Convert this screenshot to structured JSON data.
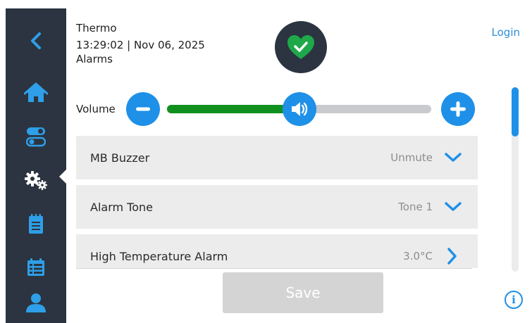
{
  "header": {
    "device_name": "Thermo",
    "datetime": "13:29:02 | Nov 06, 2025",
    "page_title": "Alarms",
    "login_label": "Login",
    "status_icon": "heart-check-icon"
  },
  "sidebar": {
    "items": [
      {
        "name": "back",
        "icon": "chevron-left-icon"
      },
      {
        "name": "home",
        "icon": "home-icon"
      },
      {
        "name": "controls",
        "icon": "toggle-icon"
      },
      {
        "name": "settings",
        "icon": "gears-icon",
        "active": true
      },
      {
        "name": "log",
        "icon": "notepad-icon"
      },
      {
        "name": "events",
        "icon": "calendar-list-icon"
      },
      {
        "name": "user",
        "icon": "user-icon"
      }
    ]
  },
  "volume": {
    "label": "Volume",
    "level_fraction": 0.5
  },
  "settings_list": [
    {
      "label": "MB Buzzer",
      "value": "Unmute",
      "icon": "chevron-down-icon"
    },
    {
      "label": "Alarm Tone",
      "value": "Tone 1",
      "icon": "chevron-down-icon"
    },
    {
      "label": "High Temperature Alarm",
      "value": "3.0°C",
      "icon": "chevron-right-icon"
    }
  ],
  "save_label": "Save",
  "colors": {
    "sidebar": "#2b3440",
    "accent_blue": "#1e90e8",
    "volume_green": "#10911f",
    "status_green": "#1ea84a",
    "row_bg": "#ececec",
    "save_disabled": "#d4d4d4"
  }
}
